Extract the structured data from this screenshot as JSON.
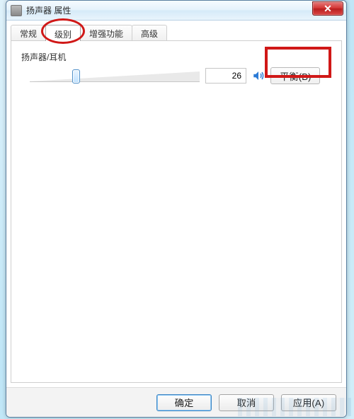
{
  "window": {
    "title": "扬声器 属性"
  },
  "tabs": [
    {
      "label": "常规",
      "active": false
    },
    {
      "label": "级别",
      "active": true
    },
    {
      "label": "增强功能",
      "active": false
    },
    {
      "label": "高级",
      "active": false
    }
  ],
  "level": {
    "section_label": "扬声器/耳机",
    "value": "26",
    "slider_percent": 26,
    "balance_button": "平衡(B)",
    "speaker_icon": "speaker-icon"
  },
  "buttons": {
    "ok": "确定",
    "cancel": "取消",
    "apply": "应用(A)"
  },
  "highlights": {
    "ellipse_on_tab": true,
    "rect_on_balance": true
  }
}
